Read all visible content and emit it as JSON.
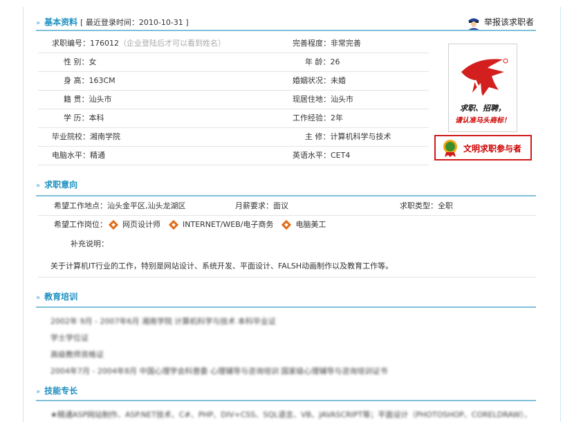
{
  "basic": {
    "title": "基本资料",
    "last_login": "[ 最近登录时间：2010-10-31 ]",
    "report_label": "举报该求职者",
    "fields": {
      "id_label": "求职编号：",
      "id_value": "176012",
      "id_note": "（企业登陆后才可以看到姓名）",
      "complete_label": "完善程度：",
      "complete_value": "非常完善",
      "gender_label": "性 别：",
      "gender_value": "女",
      "age_label": "年 龄：",
      "age_value": "26",
      "height_label": "身 高：",
      "height_value": "163CM",
      "marital_label": "婚姻状况：",
      "marital_value": "未婚",
      "origin_label": "籍 贯：",
      "origin_value": "汕头市",
      "residence_label": "现居住地：",
      "residence_value": "汕头市",
      "edu_label": "学 历：",
      "edu_value": "本科",
      "exp_label": "工作经验：",
      "exp_value": "2年",
      "school_label": "毕业院校：",
      "school_value": "湘南学院",
      "major_label": "主 修：",
      "major_value": "计算机科学与技术",
      "computer_label": "电脑水平：",
      "computer_value": "精通",
      "english_label": "英语水平：",
      "english_value": "CET4"
    },
    "photo": {
      "slogan1": "求职、招聘，",
      "slogan2": "请认准马头商标！"
    },
    "badge": "文明求职参与者"
  },
  "intent": {
    "title": "求职意向",
    "location_label": "希望工作地点：",
    "location_value": "汕头金平区,汕头龙湖区",
    "salary_label": "月薪要求：",
    "salary_value": "面议",
    "type_label": "求职类型：",
    "type_value": "全职",
    "posts_label": "希望工作岗位：",
    "posts": [
      "网页设计师",
      "INTERNET/WEB/电子商务",
      "电脑美工"
    ],
    "extra_label": "补充说明：",
    "extra_text": "关于计算机IT行业的工作，特别是网站设计、系统开发、平面设计、FALSH动画制作以及教育工作等。"
  },
  "education": {
    "title": "教育培训",
    "lines": [
      "2002年 9月 - 2007年6月 湘南学院 计算机科学与技术 本科毕业证",
      "学士学位证",
      "高级教师资格证",
      "2004年7月 - 2004年8月 中国心理学会科普委 心理辅导与咨询培训 国家级心理辅导与咨询培训证书"
    ]
  },
  "skills": {
    "title": "技能专长",
    "line": "★精通ASP网站制作、ASP.NET技术、C#、PHP、DIV+CSS、SQL语言、VB、JAVASCRIPT等；平面设计（PHOTOSHOP、CORELDRAW）、"
  },
  "colors": {
    "accent": "#1c8fc0",
    "rule": "#7fbfd9",
    "badge_red": "#d01818",
    "post_orange": "#e36b17"
  }
}
